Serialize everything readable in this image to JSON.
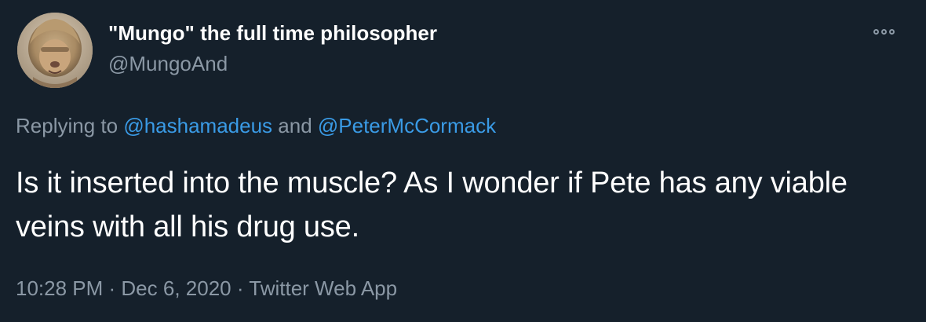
{
  "tweet": {
    "author": {
      "display_name": "\"Mungo\" the full time philosopher",
      "handle": "@MungoAnd",
      "avatar_icon": "avatar-photo"
    },
    "more_icon": "more-options-icon",
    "reply": {
      "prefix": "Replying to ",
      "mentions": [
        "@hashamadeus",
        "@PeterMcCormack"
      ],
      "joiner": " and "
    },
    "text": "Is it inserted into the muscle? As I wonder if Pete has any viable veins with all his drug use.",
    "meta": {
      "time": "10:28 PM",
      "separator": " · ",
      "date": "Dec 6, 2020",
      "app": "Twitter Web App"
    }
  },
  "colors": {
    "background": "#15202b",
    "primary_text": "#ffffff",
    "secondary_text": "#8b98a5",
    "link": "#3a9be6"
  }
}
